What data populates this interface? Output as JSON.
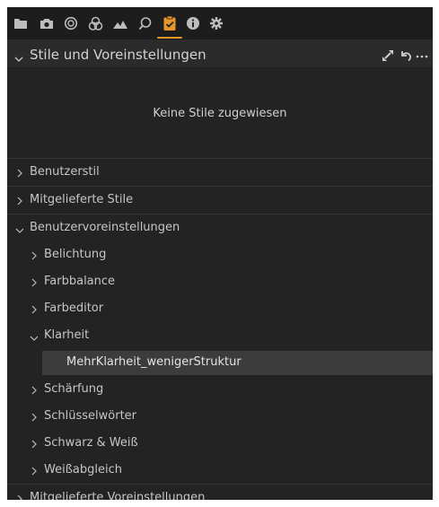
{
  "header": {
    "title": "Stile und Voreinstellungen",
    "collapse_icon": "chevron-down-icon",
    "icons": [
      "expand-arrows-icon",
      "reset-icon",
      "more-icon"
    ]
  },
  "toolbar": {
    "icons": [
      "folder-icon",
      "camera-icon",
      "color-wheel-icon",
      "color-balance-icon",
      "landscape-icon",
      "search-icon",
      "clipboard-icon",
      "info-icon",
      "settings-icon"
    ],
    "active_icon": "clipboard-icon",
    "accent_color": "#e8952a"
  },
  "empty_message": "Keine Stile zugewiesen",
  "tree": [
    {
      "label": "Benutzerstil",
      "expanded": false
    },
    {
      "label": "Mitgelieferte Stile",
      "expanded": false
    },
    {
      "label": "Benutzervoreinstellungen",
      "expanded": true
    },
    {
      "label": "Belichtung",
      "expanded": false
    },
    {
      "label": "Farbbalance",
      "expanded": false
    },
    {
      "label": "Farbeditor",
      "expanded": false
    },
    {
      "label": "Klarheit",
      "expanded": true
    },
    {
      "label": "MehrKlarheit_wenigerStruktur",
      "selected": true
    },
    {
      "label": "Schärfung",
      "expanded": false
    },
    {
      "label": "Schlüsselwörter",
      "expanded": false
    },
    {
      "label": "Schwarz & Weiß",
      "expanded": false
    },
    {
      "label": "Weißabgleich",
      "expanded": false
    },
    {
      "label": "Mitgelieferte Voreinstellungen",
      "expanded": false
    }
  ]
}
